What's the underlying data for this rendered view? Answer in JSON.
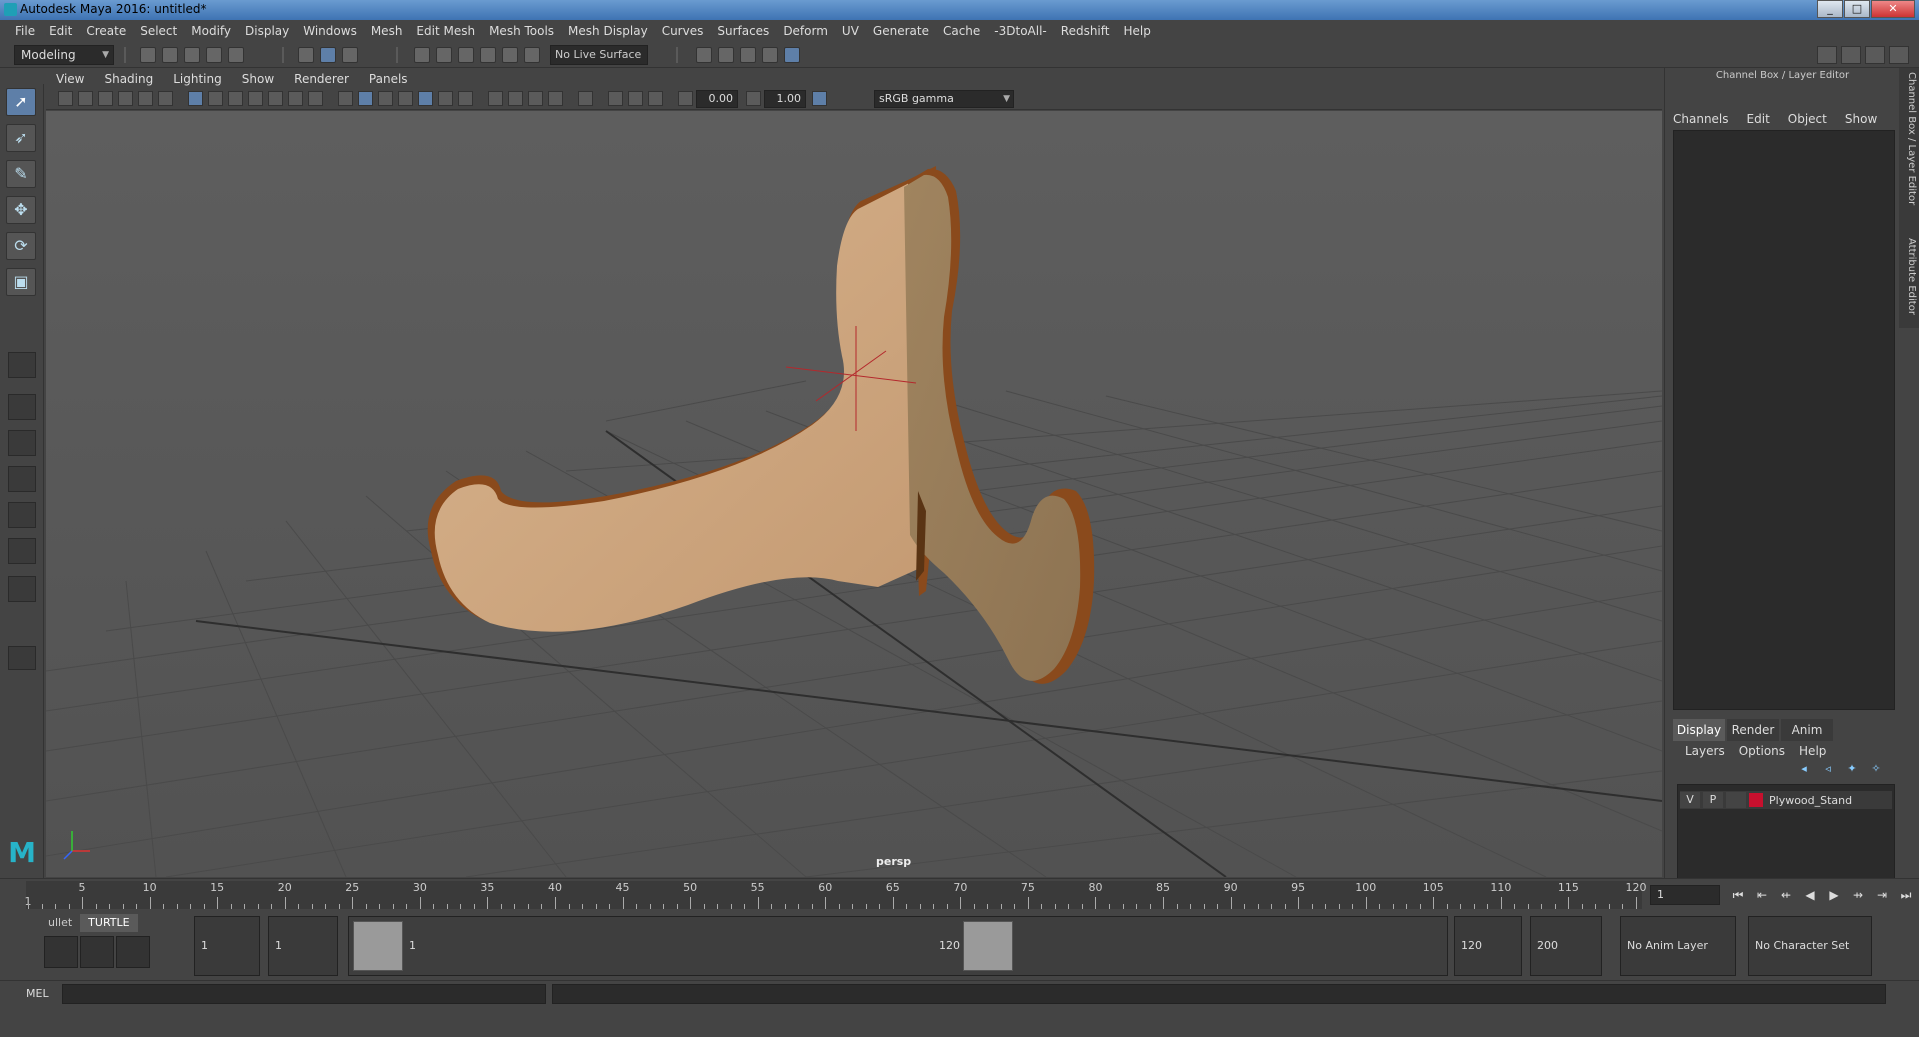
{
  "window": {
    "title": "Autodesk Maya 2016: untitled*",
    "controls": [
      "_",
      "□",
      "✕"
    ]
  },
  "menu": [
    "File",
    "Edit",
    "Create",
    "Select",
    "Modify",
    "Display",
    "Windows",
    "Mesh",
    "Edit Mesh",
    "Mesh Tools",
    "Mesh Display",
    "Curves",
    "Surfaces",
    "Deform",
    "UV",
    "Generate",
    "Cache",
    "-3DtoAll-",
    "Redshift",
    "Help"
  ],
  "statusline": {
    "mode": "Modeling",
    "live_surface": "No Live Surface"
  },
  "viewport": {
    "panel_menu": [
      "View",
      "Shading",
      "Lighting",
      "Show",
      "Renderer",
      "Panels"
    ],
    "exposure": "0.00",
    "gamma_value": "1.00",
    "color_space": "sRGB gamma",
    "camera": "persp"
  },
  "right_panel": {
    "header": "Channel Box / Layer Editor",
    "menu": [
      "Channels",
      "Edit",
      "Object",
      "Show"
    ],
    "tabs": [
      "Display",
      "Render",
      "Anim"
    ],
    "layer_menu": [
      "Layers",
      "Options",
      "Help"
    ],
    "layer": {
      "visible": "V",
      "playback": "P",
      "name": "Plywood_Stand",
      "color": "#c8102e"
    },
    "side_tabs": [
      "Channel Box / Layer Editor",
      "Attribute Editor"
    ]
  },
  "timeline": {
    "labels": [
      5,
      10,
      15,
      20,
      25,
      30,
      35,
      40,
      45,
      50,
      55,
      60,
      65,
      70,
      75,
      80,
      85,
      90,
      95,
      100,
      105,
      110,
      115,
      120
    ],
    "start_label": "1",
    "current_frame": "1",
    "playback_icons": [
      "⏮",
      "⇤",
      "⇷",
      "◀",
      "▶",
      "⇸",
      "⇥",
      "⏭"
    ]
  },
  "range": {
    "shelf_tabs": [
      "ullet",
      "TURTLE"
    ],
    "start": "1",
    "playback_start": "1",
    "range_start_label": "1",
    "range_end_label": "120",
    "playback_end": "120",
    "end": "200",
    "anim_layer": "No Anim Layer",
    "character_set": "No Character Set"
  },
  "command": {
    "label": "MEL"
  }
}
